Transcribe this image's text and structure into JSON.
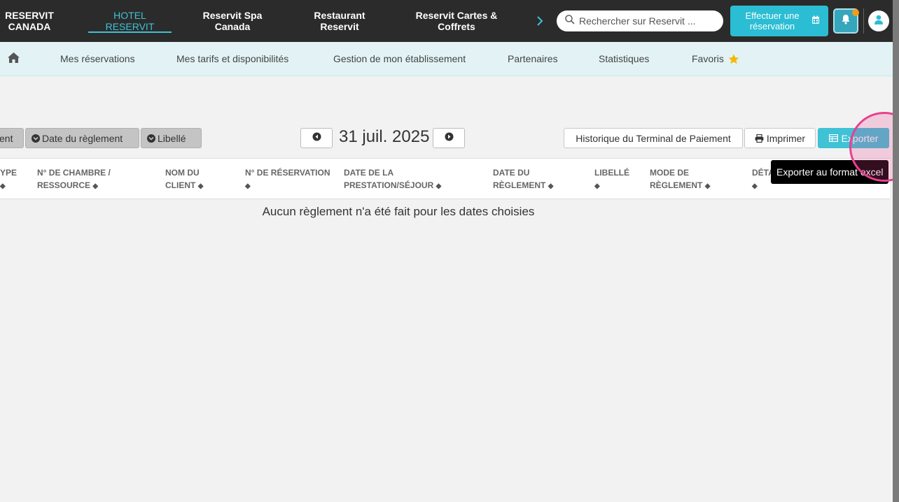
{
  "topnav": {
    "brands": [
      {
        "label": "RESERVIT CANADA",
        "l1": "RESERVIT",
        "l2": "CANADA"
      },
      {
        "label": "HOTEL RESERVIT",
        "l1": "HOTEL",
        "l2": "RESERVIT",
        "active": true
      },
      {
        "label": "Reservit Spa Canada",
        "l1": "Reservit Spa",
        "l2": "Canada"
      },
      {
        "label": "Restaurant Reservit",
        "l1": "Restaurant",
        "l2": "Reservit"
      },
      {
        "label": "Reservit Cartes & Coffrets",
        "l1": "Reservit Cartes &",
        "l2": "Coffrets"
      }
    ],
    "search_placeholder": "Rechercher sur Reservit ...",
    "book_button_l1": "Effectuer une",
    "book_button_l2": "réservation"
  },
  "subnav": {
    "items": [
      "Mes réservations",
      "Mes tarifs et disponibilités",
      "Gestion de mon établissement",
      "Partenaires",
      "Statistiques",
      "Favoris"
    ]
  },
  "toolbar": {
    "toggles": [
      "ent",
      "Date du règlement",
      "Libellé"
    ],
    "date": "31 juil. 2025",
    "history_button": "Historique du Terminal de Paiement",
    "print_button": "Imprimer",
    "export_button": "Exporter"
  },
  "table": {
    "headers": [
      {
        "l1": "YPE",
        "l2": ""
      },
      {
        "l1": "N° DE CHAMBRE /",
        "l2": "RESSOURCE"
      },
      {
        "l1": "NOM DU",
        "l2": "CLIENT"
      },
      {
        "l1": "N° DE RÉSERVATION",
        "l2": ""
      },
      {
        "l1": "DATE DE LA",
        "l2": "PRESTATION/SÉJOUR"
      },
      {
        "l1": "DATE DU",
        "l2": "RÈGLEMENT"
      },
      {
        "l1": "LIBELLÉ",
        "l2": ""
      },
      {
        "l1": "MODE DE",
        "l2": "RÈGLEMENT"
      },
      {
        "l1": "DÉTA",
        "l2": ""
      }
    ],
    "empty_message": "Aucun règlement n'a été fait pour les dates choisies"
  },
  "tooltip": "Exporter au format excel",
  "colors": {
    "accent": "#3fc2d6",
    "topbar": "#2b2b2b",
    "subnav": "#e3f3f5"
  }
}
